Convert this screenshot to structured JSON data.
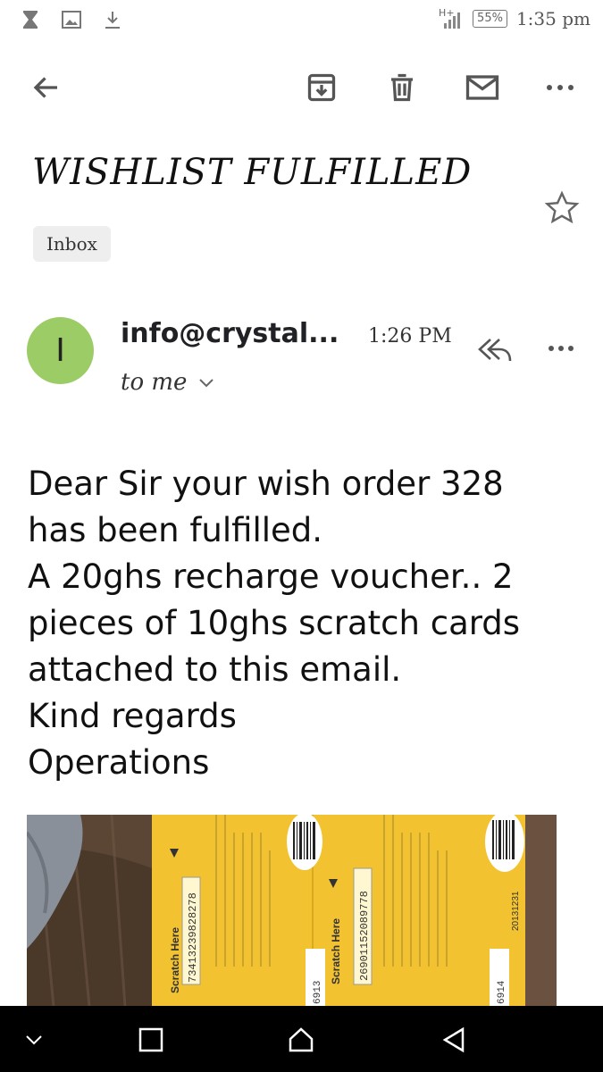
{
  "status_bar": {
    "network": "H+",
    "battery": "55%",
    "time": "1:35 pm",
    "left_icons": [
      "hourglass-icon",
      "image-icon",
      "download-icon"
    ]
  },
  "toolbar": {
    "icons": [
      "back-arrow-icon",
      "archive-icon",
      "delete-icon",
      "mail-icon",
      "more-icon"
    ]
  },
  "email": {
    "subject": "WISHLIST FULFILLED",
    "label": "Inbox",
    "sender_initial": "I",
    "sender": "info@crystal...",
    "time": "1:26 PM",
    "recipient": "to me",
    "body_lines": [
      "Dear Sir your wish order 328",
      "has been fulfilled.",
      "A 20ghs recharge voucher.. 2",
      "pieces of 10ghs scratch cards",
      "attached to this email.",
      "Kind regards",
      "Operations"
    ],
    "attachment": {
      "card1_side_label": "Scratch Here",
      "card1_number": "73413239828278",
      "card2_side_label": "Scratch Here",
      "card2_number": "26901152089778",
      "serial_fragment_1": "6913",
      "serial_fragment_2": "6914",
      "expiry": "20131231"
    }
  },
  "colors": {
    "avatar": "#9ccc65",
    "card": "#f2c230",
    "navbar": "#000000"
  }
}
